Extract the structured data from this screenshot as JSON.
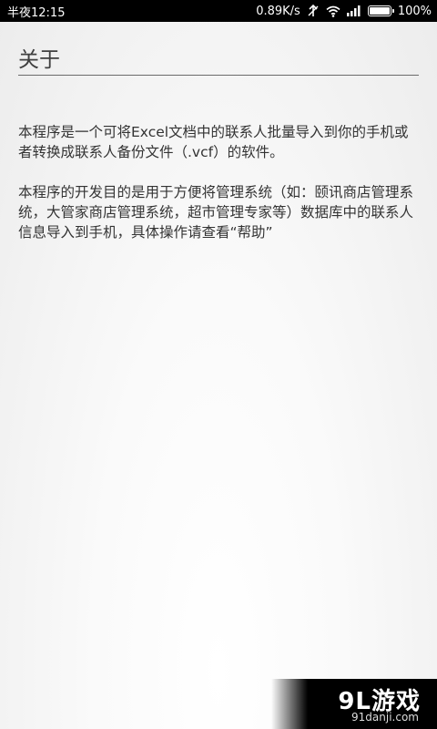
{
  "status_bar": {
    "time": "半夜12:15",
    "speed": "0.89K/s",
    "battery_text": "100%",
    "battery_level": 1.0,
    "icons": [
      "data-sync-icon",
      "wifi-icon",
      "signal-icon",
      "battery-icon"
    ]
  },
  "page": {
    "title": "关于",
    "paragraphs": [
      "本程序是一个可将Excel文档中的联系人批量导入到你的手机或者转换成联系人备份文件（.vcf）的软件。",
      "本程序的开发目的是用于方便将管理系统（如：颐讯商店管理系统，大管家商店管理系统，超市管理专家等）数据库中的联系人信息导入到手机，具体操作请查看“帮助”"
    ]
  },
  "watermark": {
    "logo": "9L游戏",
    "url": "91danji.com"
  },
  "colors": {
    "status_bar_bg": "#000000",
    "background": "#f2f2f2",
    "text": "#333333",
    "rule": "#6b6b6b"
  }
}
